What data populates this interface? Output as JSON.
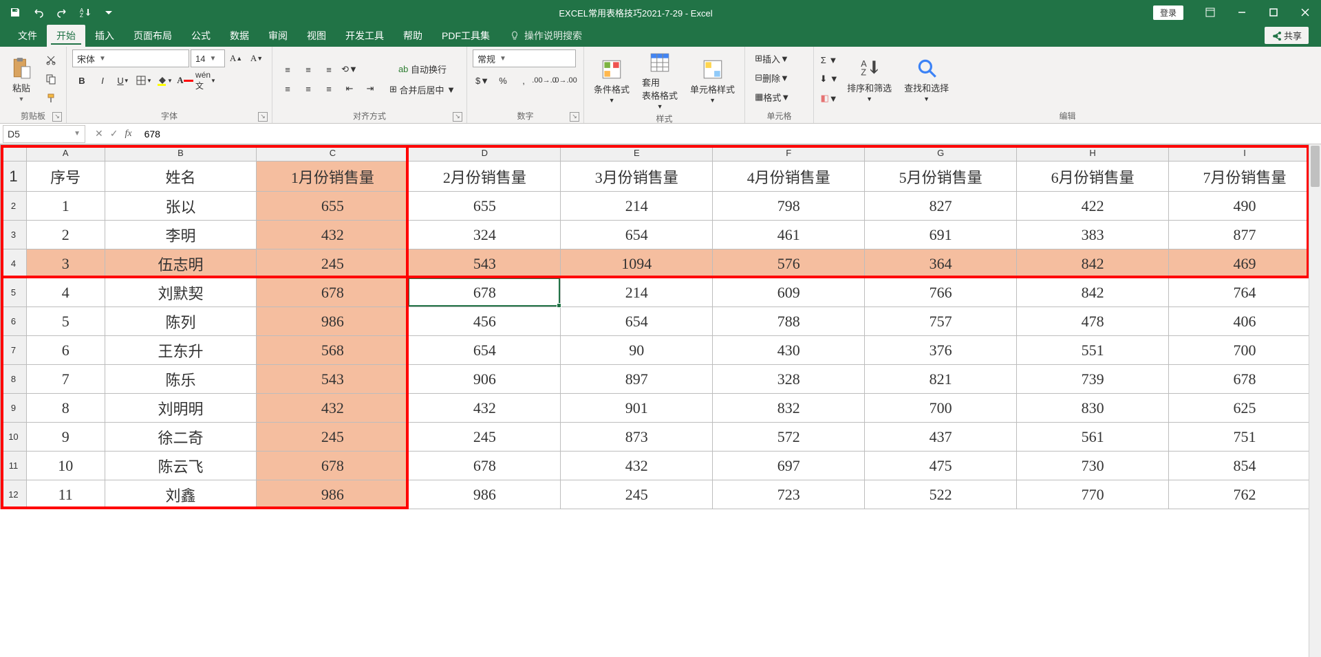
{
  "title": "EXCEL常用表格技巧2021-7-29 - Excel",
  "login": "登录",
  "tabs": {
    "file": "文件",
    "home": "开始",
    "insert": "插入",
    "layout": "页面布局",
    "formulas": "公式",
    "data": "数据",
    "review": "审阅",
    "view": "视图",
    "dev": "开发工具",
    "help": "帮助",
    "pdf": "PDF工具集",
    "tellme": "操作说明搜索"
  },
  "share": "共享",
  "ribbon": {
    "clipboard": {
      "paste": "粘贴",
      "label": "剪贴板"
    },
    "font": {
      "name": "宋体",
      "size": "14",
      "label": "字体"
    },
    "align": {
      "wrap": "自动换行",
      "merge": "合并后居中",
      "label": "对齐方式"
    },
    "number": {
      "general": "常规",
      "label": "数字"
    },
    "styles": {
      "cond": "条件格式",
      "tbl": "套用\n表格格式",
      "cell": "单元格样式",
      "label": "样式"
    },
    "cells": {
      "insert": "插入",
      "delete": "删除",
      "format": "格式",
      "label": "单元格"
    },
    "editing": {
      "sort": "排序和筛选",
      "find": "查找和选择",
      "label": "编辑"
    }
  },
  "namebox": "D5",
  "formula": "678",
  "columns": [
    "A",
    "B",
    "C",
    "D",
    "E",
    "F",
    "G",
    "H",
    "I"
  ],
  "headers": [
    "序号",
    "姓名",
    "1月份销售量",
    "2月份销售量",
    "3月份销售量",
    "4月份销售量",
    "5月份销售量",
    "6月份销售量",
    "7月份销售量"
  ],
  "rows": [
    {
      "n": "1",
      "name": "张以",
      "v": [
        655,
        655,
        214,
        798,
        827,
        422,
        490
      ]
    },
    {
      "n": "2",
      "name": "李明",
      "v": [
        432,
        324,
        654,
        461,
        691,
        383,
        877
      ]
    },
    {
      "n": "3",
      "name": "伍志明",
      "v": [
        245,
        543,
        1094,
        576,
        364,
        842,
        469
      ]
    },
    {
      "n": "4",
      "name": "刘默契",
      "v": [
        678,
        678,
        214,
        609,
        766,
        842,
        764
      ]
    },
    {
      "n": "5",
      "name": "陈列",
      "v": [
        986,
        456,
        654,
        788,
        757,
        478,
        406
      ]
    },
    {
      "n": "6",
      "name": "王东升",
      "v": [
        568,
        654,
        90,
        430,
        376,
        551,
        700
      ]
    },
    {
      "n": "7",
      "name": "陈乐",
      "v": [
        543,
        906,
        897,
        328,
        821,
        739,
        678
      ]
    },
    {
      "n": "8",
      "name": "刘明明",
      "v": [
        432,
        432,
        901,
        832,
        700,
        830,
        625
      ]
    },
    {
      "n": "9",
      "name": "徐二奇",
      "v": [
        245,
        245,
        873,
        572,
        437,
        561,
        751
      ]
    },
    {
      "n": "10",
      "name": "陈云飞",
      "v": [
        678,
        678,
        432,
        697,
        475,
        730,
        854
      ]
    },
    {
      "n": "11",
      "name": "刘鑫",
      "v": [
        986,
        986,
        245,
        723,
        522,
        770,
        762
      ]
    }
  ]
}
